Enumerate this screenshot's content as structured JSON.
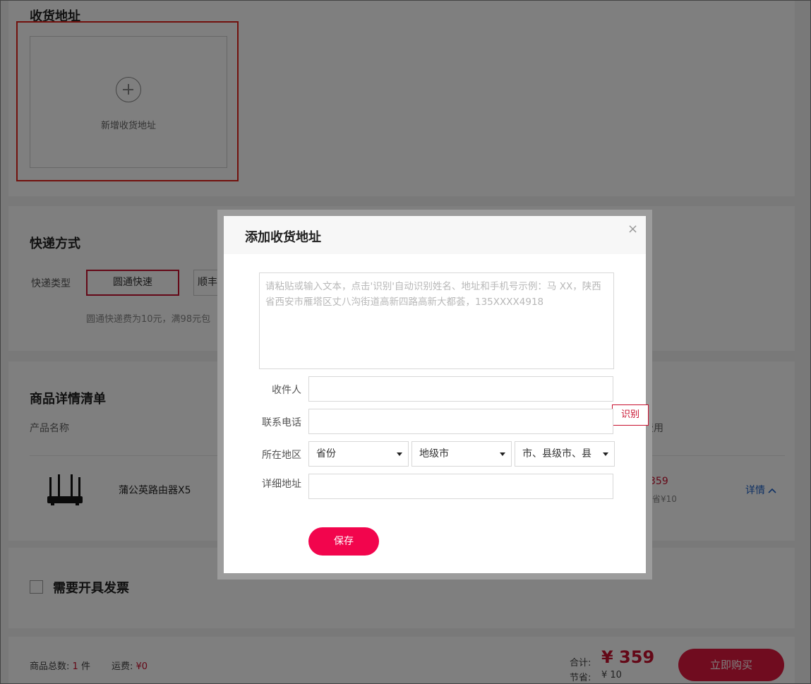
{
  "address": {
    "title": "收货地址",
    "add_label": "新增收货地址",
    "add_icon": "plus-circle-icon"
  },
  "express": {
    "title": "快递方式",
    "type_label": "快递类型",
    "options": [
      "圆通快速",
      "顺丰"
    ],
    "selected": "圆通快速",
    "note": "圆通快递费为10元，满98元包"
  },
  "goods": {
    "title": "商品详情清单",
    "col_product": "产品名称",
    "col_fee_fragment": "费用",
    "product_name": "蒲公英路由器X5",
    "price_fragment": "359",
    "save_fragment": "省¥10",
    "detail_link": "详情",
    "detail_icon": "chevron-up-icon"
  },
  "invoice": {
    "label": "需要开具发票",
    "checked": false
  },
  "bottom": {
    "count_label": "商品总数:",
    "count_value": "1",
    "count_unit": "件",
    "ship_label": "运费:",
    "ship_value": "¥0",
    "total_label": "合计:",
    "total_value": "¥ 359",
    "saved_label": "节省:",
    "saved_value": "¥ 10",
    "buy_button": "立即购买"
  },
  "modal": {
    "title": "添加收货地址",
    "close_icon": "close-icon",
    "paste_placeholder": "请粘贴或输入文本，点击'识别'自动识别姓名、地址和手机号示例：马 XX，陕西省西安市雁塔区丈八沟街道高新四路高新大都荟，135XXXX4918",
    "recognize_button": "识别",
    "labels": {
      "recipient": "收件人",
      "phone": "联系电话",
      "region": "所在地区",
      "detail": "详细地址"
    },
    "values": {
      "recipient": "",
      "phone": "",
      "detail": ""
    },
    "selects": {
      "province": "省份",
      "city": "地级市",
      "county": "市、县级市、县"
    },
    "save_button": "保存"
  },
  "colors": {
    "accent": "#c8102e",
    "save_button": "#f2054d",
    "link": "#1f62c8",
    "highlight_box": "#e4221b"
  }
}
